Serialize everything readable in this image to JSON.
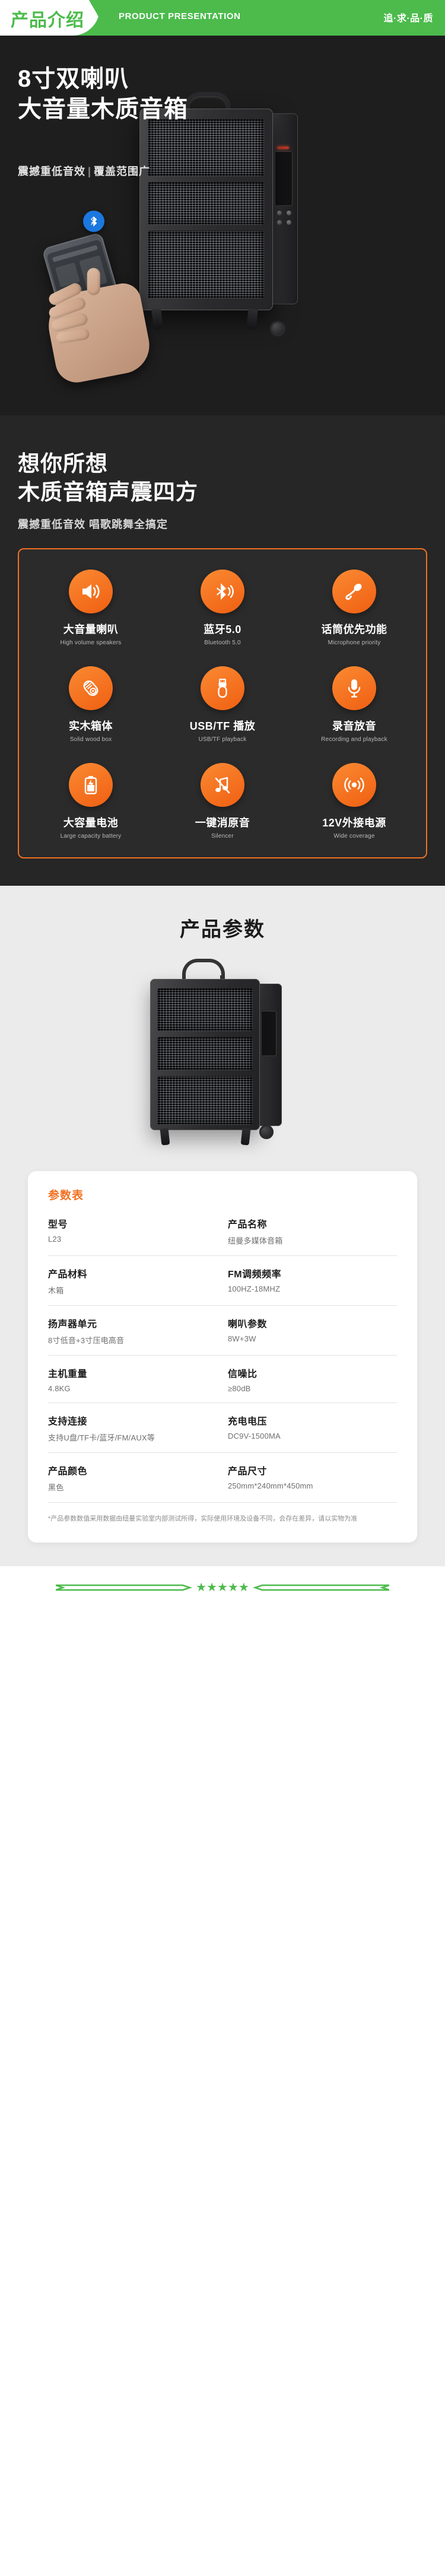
{
  "banner": {
    "title_cn": "产品介绍",
    "title_en": "PRODUCT PRESENTATION",
    "slogan": "追·求·品·质",
    "green": "#4cbb4c"
  },
  "hero": {
    "headline_line1": "8寸双喇叭",
    "headline_line2": "大音量木质音箱",
    "subtitle_left": "震撼重低音效",
    "subtitle_divider": "|",
    "subtitle_right": "覆盖范围广",
    "bluetooth_badge": "bluetooth-icon",
    "background": "#1e1e1e"
  },
  "features_section": {
    "headline_line1": "想你所想",
    "headline_line2": "木质音箱声震四方",
    "subtitle": "震撼重低音效 唱歌跳舞全搞定",
    "border_color": "#f26f21",
    "items": [
      {
        "icon": "speaker-volume-icon",
        "cn": "大音量喇叭",
        "en": "High volume speakers"
      },
      {
        "icon": "bluetooth-wave-icon",
        "cn": "蓝牙5.0",
        "en": "Bluetooth 5.0"
      },
      {
        "icon": "handheld-microphone-icon",
        "cn": "话筒优先功能",
        "en": "Microphone priority"
      },
      {
        "icon": "wood-log-icon",
        "cn": "实木箱体",
        "en": "Solid wood box"
      },
      {
        "icon": "usb-drive-icon",
        "cn": "USB/TF 播放",
        "en": "USB/TF playback"
      },
      {
        "icon": "studio-microphone-icon",
        "cn": "录音放音",
        "en": "Recording and playback"
      },
      {
        "icon": "battery-icon",
        "cn": "大容量电池",
        "en": "Large capacity battery"
      },
      {
        "icon": "music-note-mute-icon",
        "cn": "一键消原音",
        "en": "Silencer"
      },
      {
        "icon": "power-signal-icon",
        "cn": "12V外接电源",
        "en": "Wide coverage"
      }
    ]
  },
  "params_section": {
    "title": "产品参数",
    "card_title": "参数表",
    "rows": [
      [
        {
          "key": "型号",
          "value": "L23"
        },
        {
          "key": "产品名称",
          "value": "纽曼多媒体音箱"
        }
      ],
      [
        {
          "key": "产品材料",
          "value": "木箱"
        },
        {
          "key": "FM调频频率",
          "value": "100HZ-18MHZ"
        }
      ],
      [
        {
          "key": "扬声器单元",
          "value": "8寸低音+3寸压电高音"
        },
        {
          "key": "喇叭参数",
          "value": "8W+3W"
        }
      ],
      [
        {
          "key": "主机重量",
          "value": "4.8KG"
        },
        {
          "key": "信噪比",
          "value": "≥80dB"
        }
      ],
      [
        {
          "key": "支持连接",
          "value": "支持U盘/TF卡/蓝牙/FM/AUX等"
        },
        {
          "key": "充电电压",
          "value": "DC9V-1500MA"
        }
      ],
      [
        {
          "key": "产品颜色",
          "value": "黑色"
        },
        {
          "key": "产品尺寸",
          "value": "250mm*240mm*450mm"
        }
      ]
    ],
    "note": "*产品参数数值采用数据由纽曼实验室内部测试所得，实际使用环境及设备不同，会存在差异，请以实物为准"
  },
  "footer": {
    "stars": "★★★★★",
    "accent": "#4cbb4c"
  }
}
